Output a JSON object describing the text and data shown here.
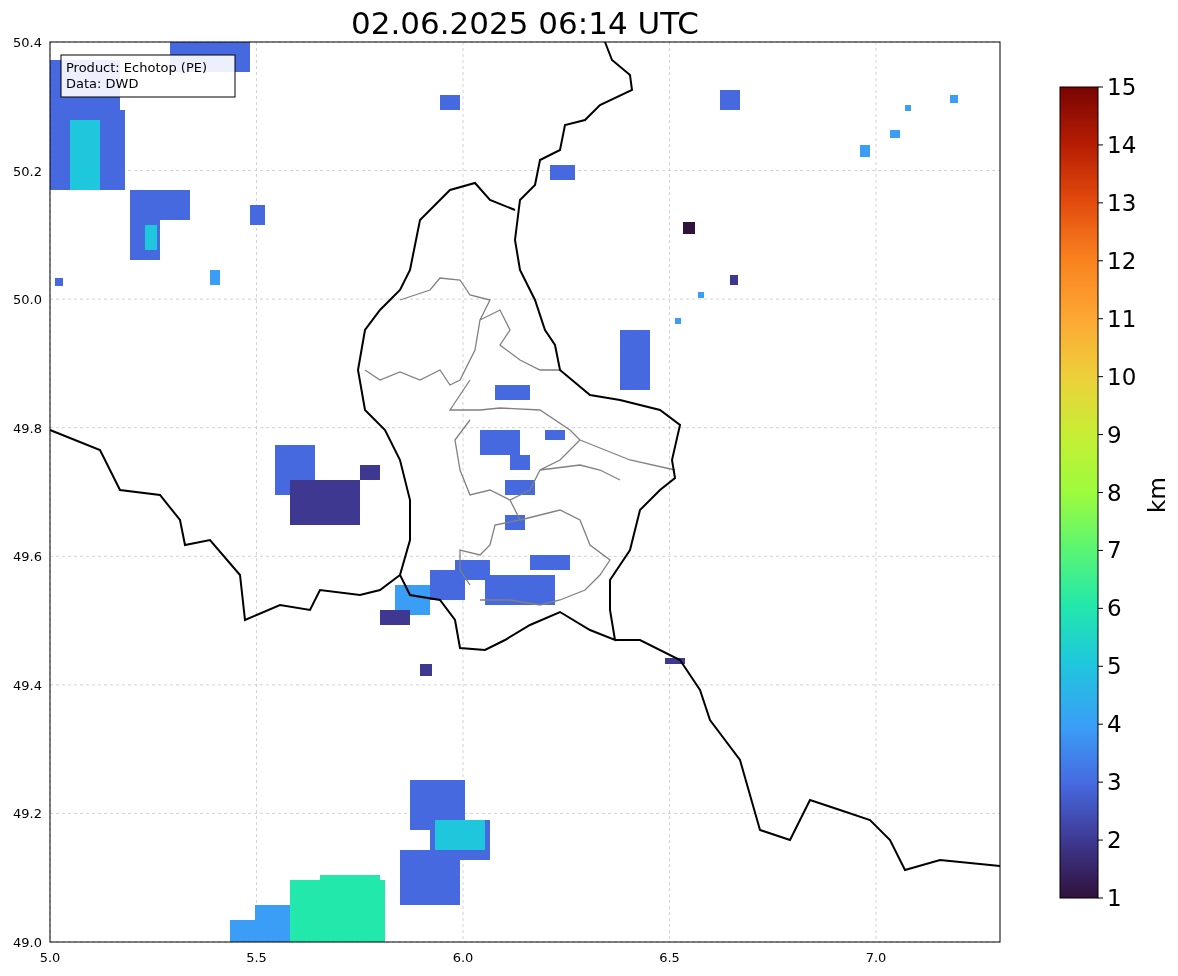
{
  "title": "02.06.2025 06:14 UTC",
  "map": {
    "xticks": [
      "5.0",
      "5.5",
      "6.0",
      "6.5",
      "7.0"
    ],
    "yticks": [
      "50.4",
      "50.2",
      "50.0",
      "49.8",
      "49.6",
      "49.4",
      "49.2",
      "49.0"
    ],
    "legend": [
      "Product: Echotop (PE)",
      "Data: DWD"
    ]
  },
  "colorbar": {
    "label": "km",
    "ticks": [
      "15",
      "14",
      "13",
      "12",
      "11",
      "10",
      "9",
      "8",
      "7",
      "6",
      "5",
      "4",
      "3",
      "2",
      "1"
    ]
  }
}
